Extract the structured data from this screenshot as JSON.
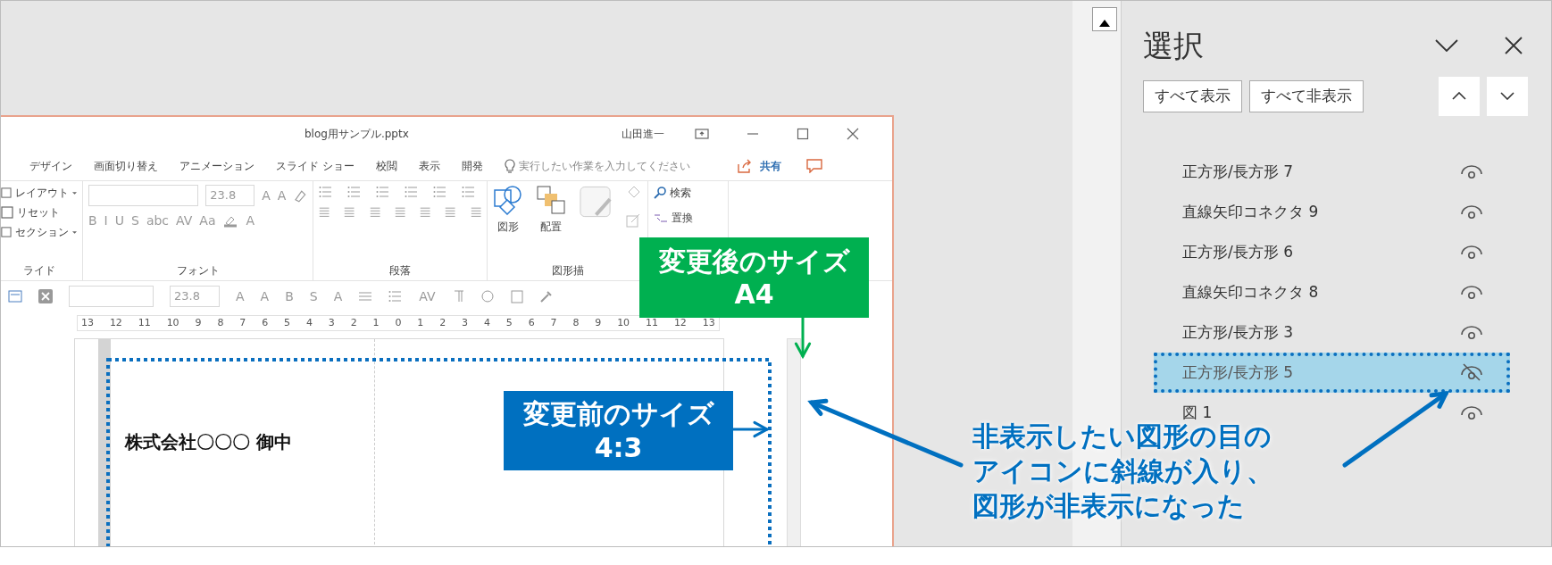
{
  "embedded_window": {
    "title": "blog用サンプル.pptx",
    "user": "山田進一",
    "tabs": [
      "デザイン",
      "画面切り替え",
      "アニメーション",
      "スライド ショー",
      "校閲",
      "表示",
      "開発"
    ],
    "tell_me": "実行したい作業を入力してください",
    "share": "共有",
    "ribbon": {
      "slides_group": {
        "buttons": [
          {
            "label": "レイアウト",
            "dropdown": true
          },
          {
            "label": "リセット",
            "dropdown": false
          },
          {
            "label": "セクション",
            "dropdown": true
          }
        ],
        "label": "ライド"
      },
      "font_group": {
        "font_size": "23.8",
        "size_buttons": [
          "A",
          "A"
        ],
        "format_buttons": [
          "B",
          "I",
          "U",
          "S",
          "abc",
          "AV",
          "Aa"
        ],
        "color_button": "A",
        "label": "フォント"
      },
      "paragraph_group": {
        "label": "段落"
      },
      "drawing_group": {
        "buttons": [
          "図形",
          "配置"
        ],
        "label": "図形描"
      },
      "editing_group": {
        "buttons": [
          "検索",
          "置換"
        ]
      }
    },
    "mini_toolbar": {
      "font_size": "23.8",
      "buttons": [
        "A",
        "A",
        "B",
        "S",
        "A"
      ],
      "spacing": "AV"
    },
    "ruler": [
      "13",
      "12",
      "11",
      "10",
      "9",
      "8",
      "7",
      "6",
      "5",
      "4",
      "3",
      "2",
      "1",
      "0",
      "1",
      "2",
      "3",
      "4",
      "5",
      "6",
      "7",
      "8",
      "9",
      "10",
      "11",
      "12",
      "13"
    ],
    "slide": {
      "text": "株式会社〇〇〇 御中"
    }
  },
  "selection_pane": {
    "title": "選択",
    "show_all": "すべて表示",
    "hide_all": "すべて非表示",
    "items": [
      {
        "label": "正方形/長方形 7",
        "visible": true,
        "selected": false
      },
      {
        "label": "直線矢印コネクタ 9",
        "visible": true,
        "selected": false
      },
      {
        "label": "正方形/長方形 6",
        "visible": true,
        "selected": false
      },
      {
        "label": "直線矢印コネクタ 8",
        "visible": true,
        "selected": false
      },
      {
        "label": "正方形/長方形 3",
        "visible": true,
        "selected": false
      },
      {
        "label": "正方形/長方形 5",
        "visible": false,
        "selected": true
      },
      {
        "label": "図 1",
        "visible": true,
        "selected": false
      }
    ]
  },
  "annotations": {
    "after_size": {
      "title": "変更後のサイズ",
      "value": "A4"
    },
    "before_size": {
      "title": "変更前のサイズ",
      "value": "4:3"
    },
    "callout": [
      "非表示したい図形の目の",
      "アイコンに斜線が入り、",
      "図形が非表示になった"
    ]
  }
}
